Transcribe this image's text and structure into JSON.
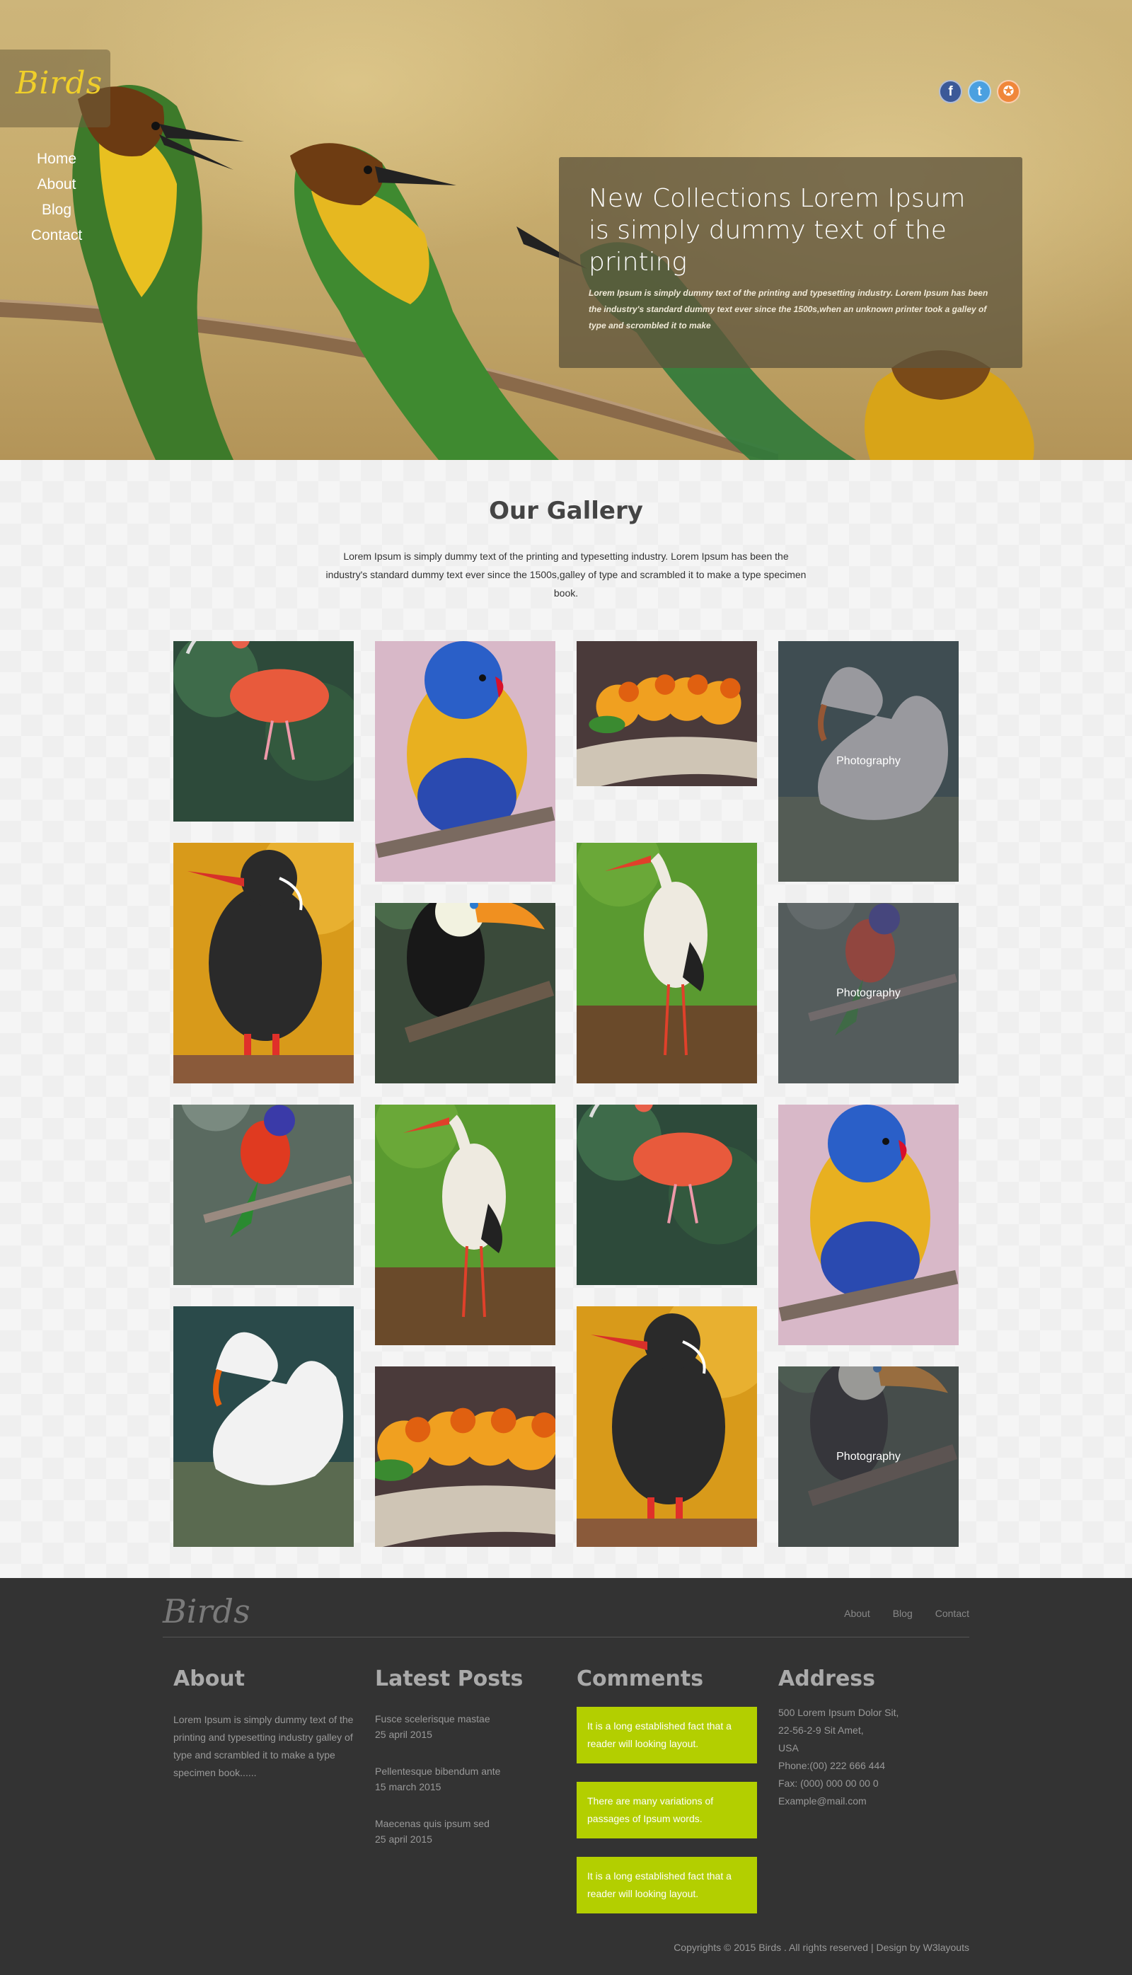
{
  "brand": {
    "name": "Birds",
    "logo_color": "#f0cf2a"
  },
  "nav": {
    "items": [
      "Home",
      "About",
      "Blog",
      "Contact"
    ]
  },
  "social": [
    {
      "icon": "facebook-icon",
      "glyph": "f",
      "color": "#3b5998"
    },
    {
      "icon": "twitter-icon",
      "glyph": "t",
      "color": "#4ba0e0"
    },
    {
      "icon": "dribbble-icon",
      "glyph": "✪",
      "color": "#f0873a"
    }
  ],
  "hero": {
    "title": "New Collections Lorem Ipsum is simply dummy text of the printing",
    "description": "Lorem Ipsum is simply dummy text of the printing and typesetting industry. Lorem Ipsum has been the industry's standard dummy text ever since the 1500s,when an unknown printer took a galley of type and scrombled it to make"
  },
  "gallery": {
    "title": "Our Gallery",
    "description": "Lorem Ipsum is simply dummy text of the printing and typesetting industry. Lorem Ipsum has been the industry's standard dummy text ever since the 1500s,galley of type and scrambled it to make a type specimen book.",
    "hover_label": "Photography",
    "tiles": [
      {
        "bird": "scarlet-ibis",
        "overlay": false
      },
      {
        "bird": "lorikeet",
        "overlay": false
      },
      {
        "bird": "lovebirds",
        "overlay": false
      },
      {
        "bird": "swan",
        "overlay": true
      },
      {
        "bird": "inca-tern",
        "overlay": false
      },
      {
        "bird": "toucan",
        "overlay": false
      },
      {
        "bird": "stork",
        "overlay": false
      },
      {
        "bird": "lorikeet-small",
        "overlay": true
      },
      {
        "bird": "lorikeet-small",
        "overlay": false
      },
      {
        "bird": "stork",
        "overlay": false
      },
      {
        "bird": "scarlet-ibis",
        "overlay": false
      },
      {
        "bird": "lorikeet",
        "overlay": false
      },
      {
        "bird": "swan",
        "overlay": false
      },
      {
        "bird": "lovebirds",
        "overlay": false
      },
      {
        "bird": "inca-tern",
        "overlay": false
      },
      {
        "bird": "toucan",
        "overlay": true
      }
    ]
  },
  "footer": {
    "brand": "Birds",
    "nav": [
      "About",
      "Blog",
      "Contact"
    ],
    "about": {
      "heading": "About",
      "text": "Lorem Ipsum is simply dummy text of the printing and typesetting industry galley of type and scrambled it to make a type specimen book......"
    },
    "posts": {
      "heading": "Latest Posts",
      "items": [
        {
          "title": "Fusce scelerisque mastae",
          "date": "25 april 2015"
        },
        {
          "title": "Pellentesque bibendum ante",
          "date": "15 march 2015"
        },
        {
          "title": "Maecenas quis ipsum sed",
          "date": "25 april 2015"
        }
      ]
    },
    "comments": {
      "heading": "Comments",
      "items": [
        "It is a long established fact that a reader will looking layout.",
        "There are many variations of passages of Ipsum words.",
        "It is a long established fact that a reader will looking layout."
      ],
      "color": "#b3cf00"
    },
    "address": {
      "heading": "Address",
      "lines": [
        "500 Lorem Ipsum Dolor Sit,",
        "22-56-2-9 Sit Amet,",
        "USA",
        "Phone:(00) 222 666 444",
        "Fax: (000) 000 00 00 0",
        "Example@mail.com"
      ]
    },
    "copyright": "Copyrights © 2015 Birds . All rights reserved | Design by W3layouts"
  }
}
